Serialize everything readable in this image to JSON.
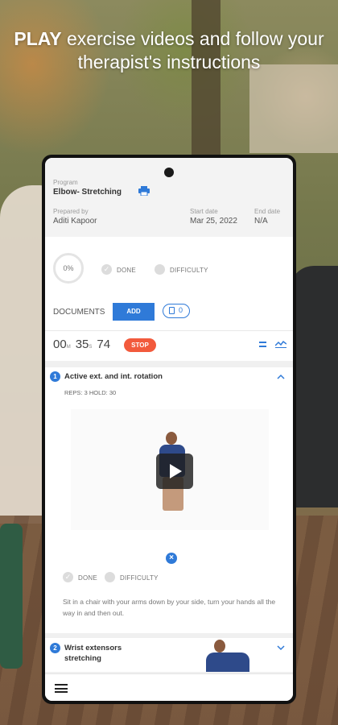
{
  "headline": {
    "bold": "PLAY",
    "rest": " exercise videos and follow your therapist's instructions"
  },
  "program": {
    "program_label": "Program",
    "program_name": "Elbow- Stretching",
    "prepared_label": "Prepared by",
    "prepared_by": "Aditi Kapoor",
    "start_label": "Start date",
    "start_date": "Mar 25, 2022",
    "end_label": "End date",
    "end_date": "N/A"
  },
  "progress": {
    "percent": "0%",
    "done_label": "DONE",
    "difficulty_label": "DIFFICULTY"
  },
  "documents": {
    "label": "DOCUMENTS",
    "add_label": "ADD",
    "count": "0"
  },
  "timer": {
    "hours": "00",
    "hours_unit": "M",
    "minutes": "35",
    "minutes_unit": "S",
    "seconds": "74",
    "stop_label": "STOP"
  },
  "exercises": [
    {
      "number": "1",
      "title": "Active ext. and int. rotation",
      "meta": "REPS: 3   HOLD: 30",
      "done_label": "DONE",
      "difficulty_label": "DIFFICULTY",
      "description": "Sit in a chair with your arms down by your side, turn your hands all the way in and then out."
    },
    {
      "number": "2",
      "title_line1": "Wrist extensors",
      "title_line2": "stretching"
    }
  ],
  "colors": {
    "accent": "#2f7ad8",
    "stop": "#f25a3c"
  }
}
